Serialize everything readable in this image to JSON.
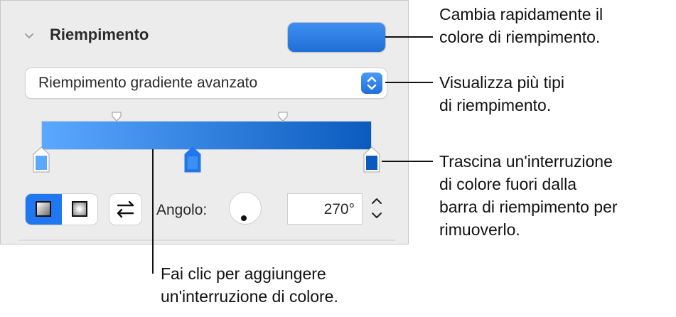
{
  "panel": {
    "section_title": "Riempimento",
    "fill_type_selected": "Riempimento gradiente avanzato",
    "angle_label": "Angolo:",
    "angle_value": "270°",
    "fill_color": "#2a7ee6",
    "gradient_start_color": "#5aa8ff",
    "gradient_end_color": "#0b5bbf",
    "accent_color": "#1f77f2"
  },
  "callouts": {
    "fill_color_1": "Cambia rapidamente il",
    "fill_color_2": "colore di riempimento.",
    "fill_types_1": "Visualizza più tipi",
    "fill_types_2": "di riempimento.",
    "drag_stop_1": "Trascina un'interruzione",
    "drag_stop_2": "di colore fuori dalla",
    "drag_stop_3": "barra di riempimento per",
    "drag_stop_4": "rimuoverlo.",
    "add_stop_1": "Fai clic per aggiungere",
    "add_stop_2": "un'interruzione di colore."
  },
  "icons": [
    "chevron-down-icon",
    "up-down-arrows-icon",
    "linear-gradient-icon",
    "radial-gradient-icon",
    "swap-arrows-icon",
    "stepper-arrows-icon"
  ]
}
